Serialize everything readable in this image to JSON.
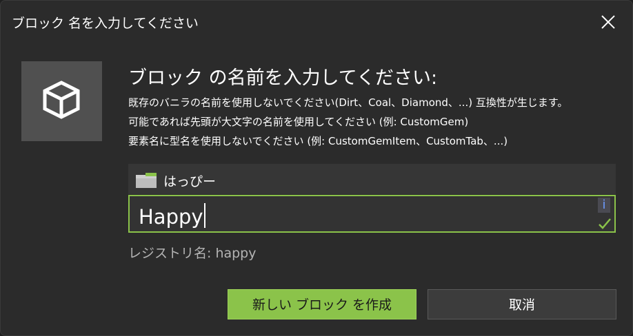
{
  "window": {
    "title": "ブロック 名を入力してください"
  },
  "dialog": {
    "heading": "ブロック の名前を入力してください:",
    "description_lines": [
      "既存のバニラの名前を使用しないでください(Dirt、Coal、Diamond、...) 互換性が生じます。",
      "可能であれば先頭が大文字の名前を使用してください (例: CustomGem)",
      "要素名に型名を使用しないでください (例: CustomGemItem、CustomTab、...)"
    ],
    "folder": {
      "icon": "folder-icon",
      "label": "はっぴー"
    },
    "name_input": {
      "value": "Happy",
      "info_icon": "i",
      "valid": true
    },
    "registry_name": "レジストリ名: happy",
    "buttons": {
      "create": "新しい ブロック を作成",
      "cancel": "取消"
    }
  },
  "colors": {
    "accent": "#8bc34a",
    "background": "#2b2b2b",
    "info": "#6d9bff"
  }
}
